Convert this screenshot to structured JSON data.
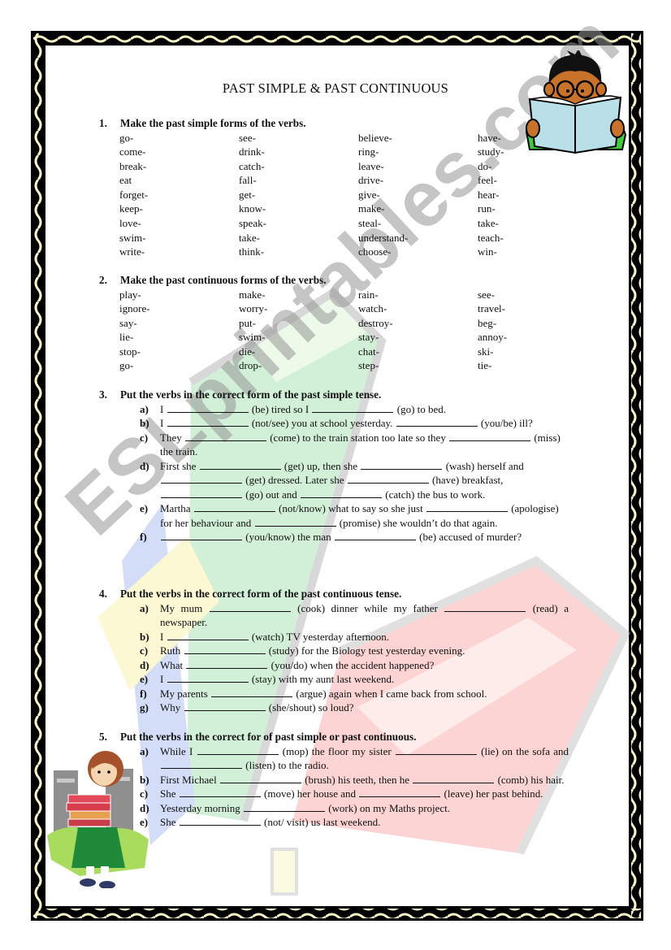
{
  "document": {
    "title": "PAST SIMPLE & PAST CONTINUOUS",
    "watermark": "ESLprintables.com"
  },
  "sections": [
    {
      "number": "1.",
      "heading": "Make the past simple forms of the verbs.",
      "columns": [
        [
          "go-",
          "come-",
          "break-",
          "eat",
          "forget-",
          "keep-",
          "love-",
          "swim-",
          "write-"
        ],
        [
          "see-",
          "drink-",
          "catch-",
          "fall-",
          "get-",
          "know-",
          "speak-",
          "take-",
          "think-"
        ],
        [
          "believe-",
          "ring-",
          "leave-",
          "drive-",
          "give-",
          "make-",
          "steal-",
          "understand-",
          "choose-"
        ],
        [
          "have-",
          "study-",
          "do-",
          "feel-",
          "hear-",
          "run-",
          "take-",
          "teach-",
          "win-"
        ]
      ]
    },
    {
      "number": "2.",
      "heading": "Make the past continuous forms of the verbs.",
      "columns": [
        [
          "play-",
          "ignore-",
          "say-",
          "lie-",
          "stop-",
          "go-"
        ],
        [
          "make-",
          "worry-",
          "put-",
          "swim-",
          "die-",
          "drop-"
        ],
        [
          "rain-",
          "watch-",
          "destroy-",
          "stay-",
          "chat-",
          "step-"
        ],
        [
          "see-",
          "travel-",
          "beg-",
          "annoy-",
          "ski-",
          "tie-"
        ]
      ]
    },
    {
      "number": "3.",
      "heading": "Put the verbs in the correct form of the past simple tense.",
      "items": [
        {
          "letter": "a)",
          "parts": [
            "I ",
            "_",
            " (be) tired so I ",
            "_",
            " (go) to bed."
          ]
        },
        {
          "letter": "b)",
          "parts": [
            "I ",
            "_",
            " (not/see) you at school yesterday. ",
            "_",
            " (you/be) ill?"
          ]
        },
        {
          "letter": "c)",
          "parts": [
            "They ",
            "_",
            " (come) to the train station too late so they ",
            "_",
            " (miss) the train."
          ]
        },
        {
          "letter": "d)",
          "parts": [
            "First she ",
            "_",
            " (get) up, then she ",
            "_",
            " (wash) herself and ",
            "_",
            " (get) dressed. Later she ",
            "_",
            " (have) breakfast, ",
            "_",
            " (go) out and ",
            "_",
            " (catch) the bus to work."
          ]
        },
        {
          "letter": "e)",
          "parts": [
            "Martha ",
            "_",
            " (not/know) what to say so she just ",
            "_",
            " (apologise) for her behaviour and ",
            "_",
            " (promise) she wouldn’t do that again."
          ]
        },
        {
          "letter": "f)",
          "parts": [
            "",
            "_",
            " (you/know) the man ",
            "_",
            " (be) accused of murder?"
          ]
        }
      ]
    },
    {
      "number": "4.",
      "heading": "Put the verbs in the correct form of the past continuous tense.",
      "items": [
        {
          "letter": "a)",
          "parts": [
            "My mum ",
            "_",
            " (cook) dinner while my father ",
            "_",
            " (read) a newspaper."
          ]
        },
        {
          "letter": "b)",
          "parts": [
            "I ",
            "_",
            " (watch) TV yesterday afternoon."
          ]
        },
        {
          "letter": "c)",
          "parts": [
            "Ruth ",
            "_",
            " (study) for the Biology test yesterday evening."
          ]
        },
        {
          "letter": "d)",
          "parts": [
            "What ",
            "_",
            " (you/do) when the accident happened?"
          ]
        },
        {
          "letter": "e)",
          "parts": [
            "I ",
            "_",
            " (stay) with my aunt last weekend."
          ]
        },
        {
          "letter": "f)",
          "parts": [
            "My parents ",
            "_",
            " (argue) again when I came back from school."
          ]
        },
        {
          "letter": "g)",
          "parts": [
            "Why ",
            "_",
            " (she/shout) so loud?"
          ]
        }
      ]
    },
    {
      "number": "5.",
      "heading": "Put the verbs in the correct for of past simple or past continuous.",
      "items": [
        {
          "letter": "a)",
          "parts": [
            "While I ",
            "_",
            " (mop) the floor my sister ",
            "_",
            " (lie) on the sofa and ",
            "_",
            " (listen) to the radio."
          ]
        },
        {
          "letter": "b)",
          "parts": [
            "First Michael ",
            "_",
            " (brush) his teeth, then he ",
            "_",
            " (comb) his hair."
          ]
        },
        {
          "letter": "c)",
          "parts": [
            "She ",
            "_",
            " (move) her house and ",
            "_",
            " (leave) her past behind."
          ]
        },
        {
          "letter": "d)",
          "parts": [
            "Yesterday morning ",
            "_",
            " (work) on my Maths project."
          ]
        },
        {
          "letter": "e)",
          "parts": [
            "She ",
            "_",
            " (not/ visit) us last weekend."
          ]
        }
      ]
    }
  ],
  "images": {
    "boy": "boy-reading-book",
    "girl": "girl-carrying-books",
    "background": "stack-of-books"
  }
}
